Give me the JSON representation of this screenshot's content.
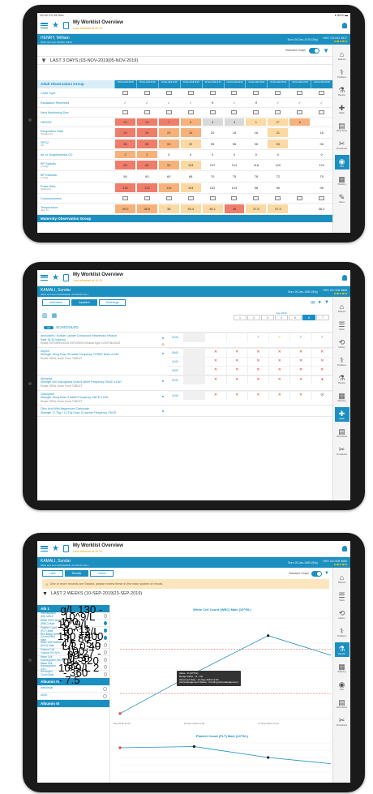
{
  "common": {
    "status_time": "10:42 Fri 15 Dec",
    "status_battery": "▾ 85% ▬",
    "app_title": "My Worklist Overview",
    "app_subtitle": "Last refreshed at 10:33"
  },
  "screen1": {
    "patient_name": "HENRY, William",
    "patient_sub": "Ward and bed NEWEL WE23",
    "dob": "Born 09-Dec-1978 (39y)",
    "nhs": "NHS 716 843 3817",
    "toggle_label": "Standard Graph",
    "period": "LAST 3 DAYS (03-NOV-2019|05-NOV-2019)",
    "group_header": "Adult Observation Group",
    "col_headers": [
      "05-Nov-2019 08:00",
      "05-Nov-2019 04:00",
      "04-Nov-2019 22:00",
      "04-Nov-2019 18:00",
      "04-Nov-2019 14:00",
      "04-Nov-2019 10:00",
      "04-Nov-2019 06:00",
      "04-Nov-2019 02:00",
      "03-Nov-2019 22:00",
      "03-Nov-2019 18:00"
    ],
    "rows": [
      {
        "label": "Chart Type",
        "sub": "",
        "cells": [
          "▭",
          "▭",
          "▭",
          "▭",
          "▭",
          "▭",
          "▭",
          "▭",
          "▭",
          "▭"
        ],
        "colors": [
          "",
          "",
          "",
          "",
          "",
          "",
          "",
          "",
          "",
          ""
        ]
      },
      {
        "label": "Escalation Reviewed",
        "sub": "",
        "cells": [
          "✓",
          "✓",
          "✓",
          "✓",
          "✕",
          "✓",
          "✕",
          "✓",
          "✓",
          "✓"
        ],
        "colors": [
          "",
          "",
          "",
          "",
          "",
          "",
          "",
          "",
          "",
          ""
        ]
      },
      {
        "label": "Next Monitoring Due",
        "sub": "",
        "cells": [
          "▭",
          "▭",
          "▭",
          "▭",
          "▭",
          "▭",
          "▭",
          "▭",
          "▭",
          "▭"
        ],
        "colors": [
          "",
          "",
          "",
          "",
          "",
          "",
          "",
          "",
          "",
          ""
        ]
      },
      {
        "label": "NEWS2",
        "sub": "",
        "cells": [
          "10",
          "10",
          "7",
          "6",
          "3",
          "3",
          "1",
          "2*",
          "6",
          ""
        ],
        "colors": [
          "r",
          "r",
          "r",
          "o",
          "g",
          "g",
          "y",
          "y",
          "o",
          ""
        ]
      },
      {
        "label": "Respiration Rate",
        "sub": "(breaths/min)",
        "cells": [
          "26",
          "26",
          "24",
          "24",
          "20",
          "18",
          "16",
          "21",
          "",
          "18"
        ],
        "colors": [
          "r",
          "r",
          "o",
          "o",
          "",
          "",
          "",
          "y",
          "",
          ""
        ]
      },
      {
        "label": "SPO2",
        "sub": "(%)",
        "cells": [
          "88",
          "88",
          "90",
          "92",
          "95",
          "96",
          "96",
          "93",
          "",
          "96"
        ],
        "colors": [
          "r",
          "r",
          "o",
          "y",
          "",
          "",
          "",
          "y",
          "",
          ""
        ]
      },
      {
        "label": "Air or Supplemental O2",
        "sub": "",
        "cells": [
          "2",
          "2",
          "0",
          "0",
          "0",
          "0",
          "0",
          "0",
          "",
          "0"
        ],
        "colors": [
          "o",
          "o",
          "",
          "",
          "",
          "",
          "",
          "",
          "",
          ""
        ]
      },
      {
        "label": "BP Systolic",
        "sub": "(mmHg)",
        "cells": [
          "88",
          "88",
          "92",
          "104",
          "107",
          "114",
          "118",
          "120",
          "",
          "124"
        ],
        "colors": [
          "r",
          "r",
          "o",
          "y",
          "",
          "",
          "",
          "",
          "",
          ""
        ]
      },
      {
        "label": "BP Diastolic",
        "sub": "(mmHg)",
        "cells": [
          "56",
          "60",
          "60",
          "68",
          "70",
          "75",
          "78",
          "72",
          "",
          "75"
        ],
        "colors": [
          "",
          "",
          "",
          "",
          "",
          "",
          "",
          "",
          "",
          ""
        ]
      },
      {
        "label": "Pulse Rate",
        "sub": "(beats/min)",
        "cells": [
          "130",
          "132",
          "119",
          "104",
          "102",
          "104",
          "98",
          "96",
          "",
          "98"
        ],
        "colors": [
          "r",
          "r",
          "o",
          "y",
          "",
          "",
          "",
          "",
          "",
          ""
        ]
      },
      {
        "label": "Consciousness",
        "sub": "",
        "cells": [
          "▭",
          "▭",
          "▭",
          "▭",
          "▭",
          "▭",
          "▭",
          "▭",
          "▭",
          "▭"
        ],
        "colors": [
          "",
          "",
          "",
          "",
          "",
          "",
          "",
          "",
          "",
          ""
        ]
      },
      {
        "label": "Temperature",
        "sub": "(deg °C)",
        "cells": [
          "39.0",
          "38.6",
          "38",
          "38.4",
          "38.1",
          "38",
          "37.8",
          "37.5",
          "",
          "38.2"
        ],
        "colors": [
          "o",
          "o",
          "y",
          "y",
          "y",
          "r",
          "y",
          "y",
          "",
          ""
        ]
      }
    ],
    "footer_group": "Maternity Observation Group",
    "sidebar": [
      "Patients",
      "Problems",
      "Results",
      "Meds",
      "Documents",
      "Procedures",
      "Obs",
      "Planning",
      "Notes"
    ]
  },
  "screen2": {
    "patient_name": "KAMALI, Sundar",
    "patient_sub": "Ward and bed RUSHMERE, SUNDAR HALL",
    "dob": "Born 20-Jan-1960 (59y)",
    "nhs": "NHS 210 008 4865",
    "tabs": [
      "Admission",
      "Inpatient",
      "Discharge"
    ],
    "month": "Sep 2019",
    "days": [
      "1",
      "2",
      "3",
      "4",
      "5",
      "6",
      "7"
    ],
    "schedule_count": "12",
    "schedule_label": "SCHEDULED",
    "meds": [
      {
        "name": "Amoxicillin / Sodium Lactate Compound Intravenous Infusion",
        "dose": "Rate 16-20 mg/hour",
        "route": "Route INTRAVENOUS INFUSION Infusion type CONTINUOUS",
        "times": [
          "22:00"
        ],
        "cells": [
          [
            "",
            "",
            "",
            "✓",
            "✓",
            "✓",
            "✓"
          ]
        ]
      },
      {
        "name": "Aspirin",
        "dose": "Strength 75mg Dose 30 tablet Frequency THREE times a DAY",
        "route": "Route ORAL Dose Form TABLET",
        "times": [
          "06:00",
          "14:00",
          "18:00"
        ],
        "cells": [
          [
            "",
            "✕",
            "✕",
            "✕",
            "✕",
            "✕",
            "✕"
          ],
          [
            "",
            "✕",
            "✕",
            "✕",
            "✕",
            "✕",
            "✕"
          ],
          [
            "",
            "✕",
            "✕",
            "✕",
            "✕",
            "✕",
            "✕"
          ]
        ]
      },
      {
        "name": "Alinopine",
        "dose": "Strength 400 micrograms Dose 8 tablet Frequency ONCE a DAY",
        "route": "Route ORAL Dose Form TABLET",
        "times": [
          "22:00"
        ],
        "cells": [
          [
            "",
            "✕",
            "✕",
            "✕",
            "✕",
            "✕",
            "●"
          ]
        ]
      },
      {
        "name": "Citalopram",
        "dose": "Strength 10mg Dose 3 tablet Frequency ONCE a DAY",
        "route": "Route ORAL Dose Form TABLET",
        "times": [
          "10:00"
        ],
        "cells": [
          [
            "",
            "✕",
            "✕",
            "✕",
            "✕",
            "✕",
            "⊙"
          ]
        ]
      },
      {
        "name": "Citric Acid With Magnesium Carbonate",
        "dose": "Strength 17.75g + 11.57g Dose 10 sachet Frequency ONCE",
        "route": "",
        "times": [],
        "cells": []
      }
    ],
    "sidebar": [
      "Patients",
      "Tasks",
      "History",
      "Problems",
      "Results",
      "Planning",
      "Meds",
      "Documents",
      "Procedures"
    ]
  },
  "screen3": {
    "patient_name": "KAMALI, Sundar",
    "patient_sub": "Ward and bed RUSHMERE, SUNDAR HALL",
    "dob": "Born 20-Jan-1960 (59y)",
    "nhs": "NHS 210 008 4865",
    "tabs": [
      "Labs",
      "Results",
      "Orders"
    ],
    "toggle_label": "Standard Graph",
    "banner": "One or more records are Sealed, please review these in the main system of record.",
    "period": "LAST 2 WEEKS (10-SEP-2019|23-SEP-2019)",
    "groups": [
      {
        "name": "Alb 1",
        "items": [
          {
            "label": "Haemoglobin (Hb) MALE",
            "ref": "g/L 130 - 170",
            "on": false
          },
          {
            "label": "White Cell Count (WBC) Male",
            "ref": "10^9/L 4 - 11",
            "on": true
          },
          {
            "label": "Platelet Count (PLT) Male",
            "ref": "10^9/L 150 - 400",
            "on": true
          },
          {
            "label": "Red Blood Cell Count (RBC) Male",
            "ref": "10^12/L 4.5 - 5.5",
            "on": true
          },
          {
            "label": "Mean Cell Volume (MCV) Male",
            "ref": "fL 80 - 100",
            "on": false
          },
          {
            "label": "Packed Cell Volume (PCV)/H...",
            "ref": "L/L 0.40 - 0.50",
            "on": false
          },
          {
            "label": "Mean Cell Haemoglobin (MCH)",
            "ref": "pg 27 - 32",
            "on": false
          },
          {
            "label": "Mean Cell Haemoglobin Con...",
            "ref": "g/L 320 - 360",
            "on": false
          },
          {
            "label": "Neutrophil Count Male",
            "ref": "10^9/L 2 - 7.5",
            "on": false
          }
        ]
      },
      {
        "name": "Albumin IV",
        "items": [
          {
            "label": "urea result",
            "ref": "",
            "on": false
          },
          {
            "label": "UIMO",
            "ref": "",
            "on": false
          }
        ]
      },
      {
        "name": "Albumin III",
        "items": []
      }
    ],
    "sidebar": [
      "Patients",
      "Tasks",
      "History",
      "Problems",
      "Results",
      "Planning",
      "Obs",
      "Documents",
      "Procedures"
    ]
  },
  "chart_data": [
    {
      "type": "line",
      "title": "White Cell Count (WBC) Male (10^9/L)",
      "x": [
        "10-Sep-2019 11:00",
        "14-Sep-2019 11:00",
        "17-Sep-2019 12:10",
        "21-Sep-2019 12:17"
      ],
      "y": [
        0.8,
        7.2,
        13.2,
        9.5
      ],
      "ylim": [
        0,
        16
      ],
      "ref_range": [
        4,
        11
      ],
      "tooltip": [
        "Value : 8 (10^9/L)",
        "Range Value : (4 - 10)",
        "Observed Date : 14-Sep-2019 12:00",
        "Acknowledgement Status : Pending Acknowledgement"
      ],
      "xlabel": "",
      "ylabel": ""
    },
    {
      "type": "line",
      "title": "Platelet Count (PLT) Male (10^9/L)",
      "x": [
        "10-Sep-2019 11:00",
        "14-Sep-2019 11:00",
        "17-Sep-2019 12:10",
        "21-Sep-2019 12:17"
      ],
      "y": [
        400,
        405,
        360,
        330
      ],
      "ylim": [
        300,
        420
      ],
      "xlabel": "",
      "ylabel": ""
    }
  ]
}
